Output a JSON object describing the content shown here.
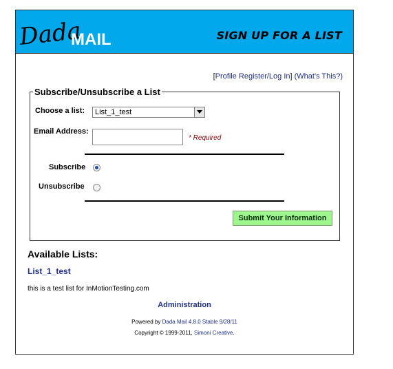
{
  "header": {
    "logo_text_dada": "Dada",
    "logo_text_mail": "MAIL",
    "title": "SIGN UP FOR A LIST",
    "background_color": "#01a8ec"
  },
  "profile_links": {
    "open_bracket": "[",
    "register_link": "Profile Register/Log In",
    "close_bracket": "]",
    "whats_this_link": "(What's This?)"
  },
  "form": {
    "legend": "Subscribe/Unsubscribe a List",
    "choose_list_label": "Choose a list:",
    "selected_list": "List_1_test",
    "email_label": "Email Address:",
    "email_value": "",
    "required_note": "* Required",
    "subscribe_label": "Subscribe",
    "subscribe_checked": true,
    "unsubscribe_label": "Unsubscribe",
    "unsubscribe_checked": false,
    "submit_label": "Submit Your Information",
    "submit_color": "#9ef58e"
  },
  "available": {
    "heading": "Available Lists:",
    "list_name": "List_1_test",
    "list_description": "this is a test list for InMotionTesting.com"
  },
  "footer": {
    "admin_link": "Administration",
    "powered_prefix": "Powered by",
    "powered_link": "Dada Mail 4.8.0 Stable 9/28/11",
    "copyright_prefix": "Copyright © 1999-2011,",
    "copyright_link": "Simoni Creative",
    "copyright_suffix": "."
  }
}
